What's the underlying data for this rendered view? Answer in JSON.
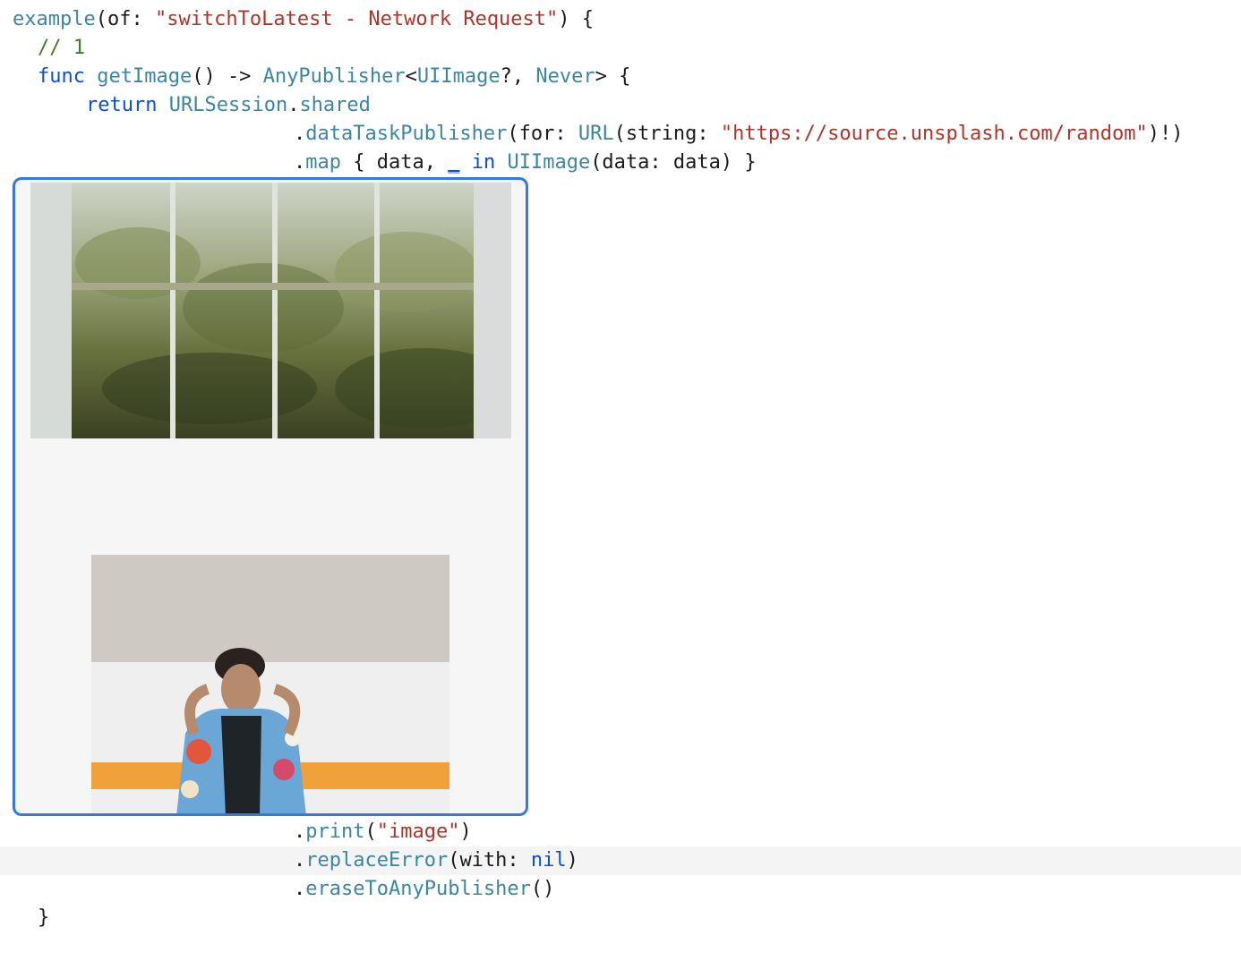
{
  "code": {
    "line1": {
      "fn": "example",
      "open": "(of: ",
      "str": "\"switchToLatest - Network Request\"",
      "close": ") {"
    },
    "line2": {
      "comment": "// 1"
    },
    "line3": {
      "kw": "func",
      "fn": "getImage",
      "mid": "() -> ",
      "ty1": "AnyPublisher",
      "lt": "<",
      "ty2": "UIImage",
      "q": "?, ",
      "ty3": "Never",
      "gt": "> {"
    },
    "line4": {
      "kw": "return",
      "ty": "URLSession",
      "dot": ".",
      "prop": "shared"
    },
    "line5": {
      "dot": ".",
      "fn": "dataTaskPublisher",
      "open": "(for: ",
      "ty": "URL",
      "arg": "(string: ",
      "str": "\"https://source.unsplash.com/random\"",
      "close": ")!)"
    },
    "line6": {
      "dot": ".",
      "fn": "map",
      "open": " { data, ",
      "und": "_",
      "sp": " ",
      "kw": "in",
      "sp2": " ",
      "ty": "UIImage",
      "close": "(data: data) }"
    },
    "line7": {
      "dot": ".",
      "fn": "print",
      "open": "(",
      "str": "\"image\"",
      "close": ")"
    },
    "line8": {
      "dot": ".",
      "fn": "replaceError",
      "open": "(with: ",
      "kw": "nil",
      "close": ")"
    },
    "line9": {
      "dot": ".",
      "fn": "eraseToAnyPublisher",
      "close": "()"
    },
    "line10": {
      "brace": "}"
    }
  },
  "preview": {
    "images": [
      {
        "name": "greenhouse-window-photo"
      },
      {
        "name": "man-in-jacket-photo"
      }
    ]
  },
  "colors": {
    "keyword": "#0b4fd6",
    "function": "#3a86a6",
    "string": "#b0342a",
    "comment": "#3a7d1f",
    "preview_border": "#3478e5"
  }
}
